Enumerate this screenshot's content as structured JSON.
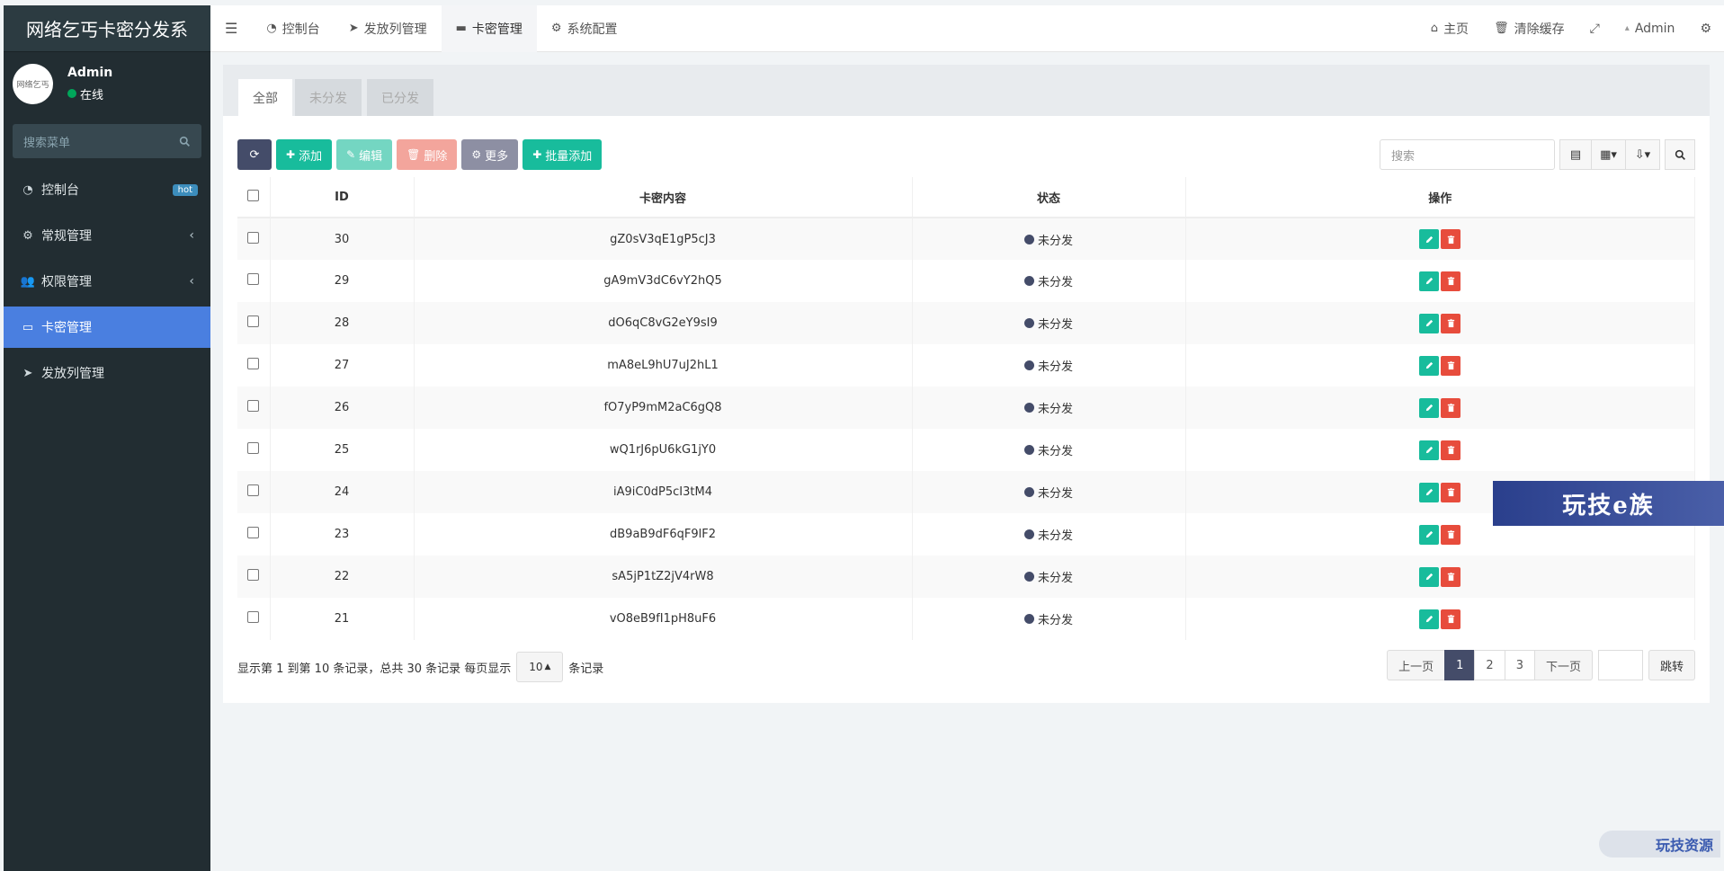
{
  "app": {
    "title": "网络乞丐卡密分发系"
  },
  "user": {
    "name": "Admin",
    "status": "在线",
    "avatar_text": "网络乞丐"
  },
  "sidebar": {
    "search_placeholder": "搜索菜单",
    "items": [
      {
        "label": "控制台",
        "icon": "dashboard-icon",
        "badge": "hot"
      },
      {
        "label": "常规管理",
        "icon": "cogs-icon",
        "has_children": true
      },
      {
        "label": "权限管理",
        "icon": "users-icon",
        "has_children": true
      },
      {
        "label": "卡密管理",
        "icon": "card-icon",
        "active": true
      },
      {
        "label": "发放列管理",
        "icon": "send-icon"
      }
    ]
  },
  "navbar": {
    "tabs": [
      {
        "label": "控制台",
        "icon": "dashboard-icon"
      },
      {
        "label": "发放列管理",
        "icon": "send-icon"
      },
      {
        "label": "卡密管理",
        "icon": "card-icon",
        "active": true
      },
      {
        "label": "系统配置",
        "icon": "gear-icon"
      }
    ],
    "home": "主页",
    "clear_cache": "清除缓存",
    "admin": "Admin"
  },
  "filter_tabs": [
    "全部",
    "未分发",
    "已分发"
  ],
  "toolbar": {
    "add": "添加",
    "edit": "编辑",
    "delete": "删除",
    "more": "更多",
    "batch_add": "批量添加",
    "search_placeholder": "搜索"
  },
  "table": {
    "columns": [
      "ID",
      "卡密内容",
      "状态",
      "操作"
    ],
    "rows": [
      {
        "id": "30",
        "content": "gZ0sV3qE1gP5cJ3",
        "status": "未分发"
      },
      {
        "id": "29",
        "content": "gA9mV3dC6vY2hQ5",
        "status": "未分发"
      },
      {
        "id": "28",
        "content": "dO6qC8vG2eY9sI9",
        "status": "未分发"
      },
      {
        "id": "27",
        "content": "mA8eL9hU7uJ2hL1",
        "status": "未分发"
      },
      {
        "id": "26",
        "content": "fO7yP9mM2aC6gQ8",
        "status": "未分发"
      },
      {
        "id": "25",
        "content": "wQ1rJ6pU6kG1jY0",
        "status": "未分发"
      },
      {
        "id": "24",
        "content": "iA9iC0dP5cI3tM4",
        "status": "未分发"
      },
      {
        "id": "23",
        "content": "dB9aB9dF6qF9lF2",
        "status": "未分发"
      },
      {
        "id": "22",
        "content": "sA5jP1tZ2jV4rW8",
        "status": "未分发"
      },
      {
        "id": "21",
        "content": "vO8eB9fI1pH8uF6",
        "status": "未分发"
      }
    ]
  },
  "pagination": {
    "info_prefix": "显示第 1 到第 10 条记录，总共 30 条记录 每页显示",
    "page_size": "10",
    "info_suffix": "条记录",
    "prev": "上一页",
    "pages": [
      "1",
      "2",
      "3"
    ],
    "current": "1",
    "next": "下一页",
    "jump": "跳转"
  },
  "watermarks": {
    "banner": "玩技e族",
    "corner": "玩技资源"
  }
}
